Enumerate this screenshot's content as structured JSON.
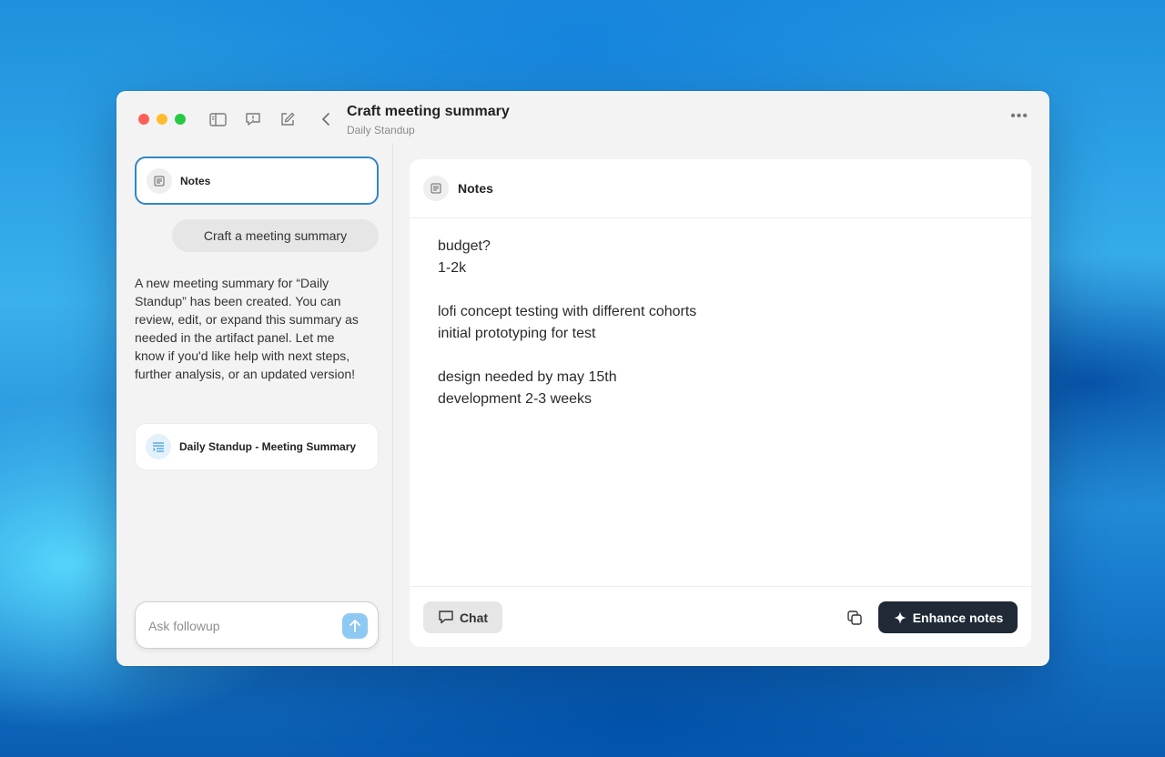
{
  "window": {
    "title": "Craft meeting summary",
    "subtitle": "Daily Standup",
    "more_label": "•••",
    "toolbar_icons": [
      "sidebar-toggle-icon",
      "feedback-icon",
      "compose-icon",
      "back-icon"
    ]
  },
  "sidebar": {
    "notes_card_label": "Notes",
    "user_message": "Craft a meeting summary",
    "assistant_message": "A new meeting summary for “Daily Standup” has been created. You can review, edit, or expand this summary as needed in the artifact panel. Let me know if you'd like help with next steps, further analysis, or an updated version!",
    "artifact_label": "Daily Standup - Meeting Summary",
    "followup_placeholder": "Ask followup"
  },
  "panel": {
    "header_label": "Notes",
    "lines": [
      "budget?",
      "1-2k",
      "",
      "lofi concept testing with different cohorts",
      "initial prototyping for test",
      "",
      "design needed by may 15th",
      "development 2-3 weeks"
    ],
    "chat_button": "Chat",
    "enhance_button": "Enhance notes"
  },
  "colors": {
    "accent_border": "#2f86c9",
    "send_button": "#8ec9f2",
    "enhance_button_bg": "#1f2a36",
    "traffic_red": "#ff5f57",
    "traffic_yellow": "#febc2e",
    "traffic_green": "#28c840"
  }
}
